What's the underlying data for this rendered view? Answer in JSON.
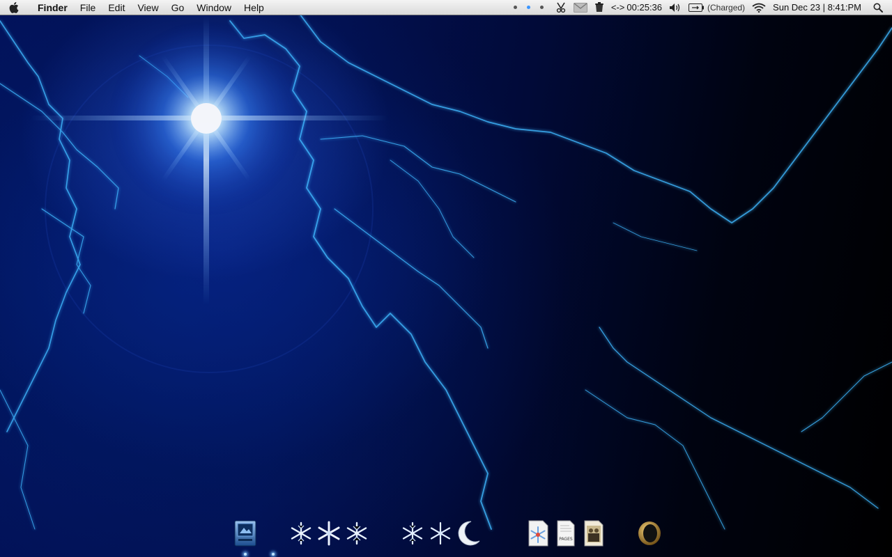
{
  "menubar": {
    "apple_icon": "apple-icon",
    "app_name": "Finder",
    "menus": [
      "File",
      "Edit",
      "View",
      "Go",
      "Window",
      "Help"
    ],
    "spaces_active_index": 1,
    "spaces_count": 3,
    "uptime": "00:25:36",
    "network_arrows": "<->",
    "battery_status": "(Charged)",
    "clock": "Sun Dec 23 | 8:41:PM",
    "icons": [
      "spaces-dots",
      "scissors-icon",
      "gmail-icon",
      "trash-icon",
      "volume-icon",
      "battery-icon",
      "wifi-icon",
      "spotlight-search-icon"
    ]
  },
  "dock": {
    "items": [
      {
        "name": "finder-stack-icon",
        "running": true
      },
      {
        "name": "snowflake-icon",
        "running": false
      },
      {
        "name": "snowflake-icon",
        "running": false
      },
      {
        "name": "snowflake-icon",
        "running": false
      },
      {
        "name": "snowflake-icon",
        "running": false
      },
      {
        "name": "snowflake-icon",
        "running": false
      },
      {
        "name": "moon-icon",
        "running": false
      },
      {
        "name": "snowflake-document-icon",
        "running": false
      },
      {
        "name": "pages-document-icon",
        "label": "PAGES",
        "running": false
      },
      {
        "name": "photo-document-icon",
        "running": false
      },
      {
        "name": "trash-ring-icon",
        "running": false
      }
    ]
  },
  "colors": {
    "wallpaper_deep": "#021050",
    "lightning": "#3fb8ff",
    "flare": "#e8f6ff",
    "menubar": "#e8e8e8",
    "space_active": "#3a95ff"
  }
}
